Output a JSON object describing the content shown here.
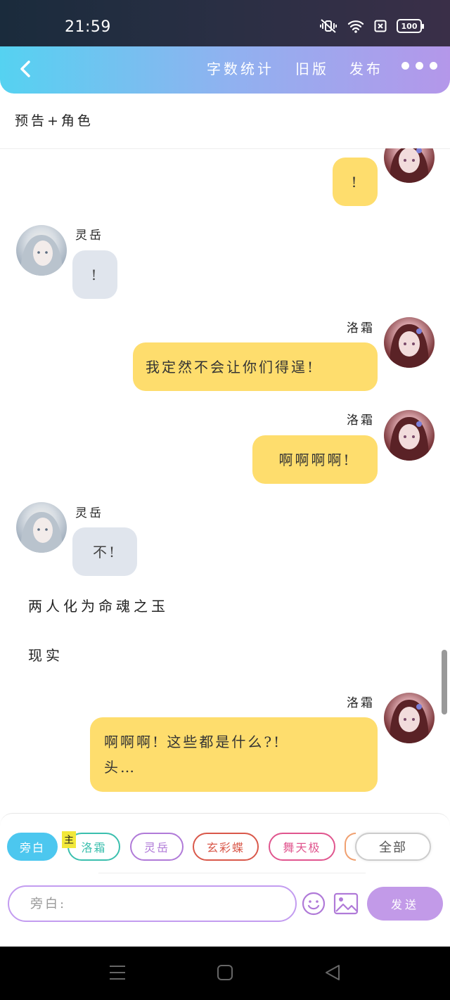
{
  "status_bar": {
    "time": "21:59",
    "battery": "100"
  },
  "header": {
    "word_count_label": "字数统计",
    "old_version_label": "旧版",
    "publish_label": "发布"
  },
  "chapter": {
    "title": "预告+角色"
  },
  "characters": {
    "right": "洛霜",
    "left": "灵岳"
  },
  "messages": [
    {
      "side": "right",
      "text": "!"
    },
    {
      "side": "left",
      "sender": "灵岳",
      "text": "!"
    },
    {
      "side": "right",
      "sender": "洛霜",
      "text": "我定然不会让你们得逞!"
    },
    {
      "side": "right",
      "sender": "洛霜",
      "text": "啊啊啊啊!"
    },
    {
      "side": "left",
      "sender": "灵岳",
      "text": "不!"
    },
    {
      "side": "narration",
      "text": "两人化为命魂之玉"
    },
    {
      "side": "narration",
      "text": "现实"
    },
    {
      "side": "right",
      "sender": "洛霜",
      "line1": "啊啊啊!  这些都是什么?!",
      "line2": "头…"
    }
  ],
  "role_bar": {
    "narration": "旁白",
    "main_tag": "主",
    "roles": [
      {
        "label": "洛霜",
        "color": "#3bbfae"
      },
      {
        "label": "灵岳",
        "color": "#b07ad8"
      },
      {
        "label": "玄彩蝶",
        "color": "#d9584a"
      },
      {
        "label": "舞天极",
        "color": "#e0558e"
      }
    ],
    "all_label": "全部"
  },
  "input": {
    "placeholder": "旁白:",
    "send_label": "发送"
  }
}
